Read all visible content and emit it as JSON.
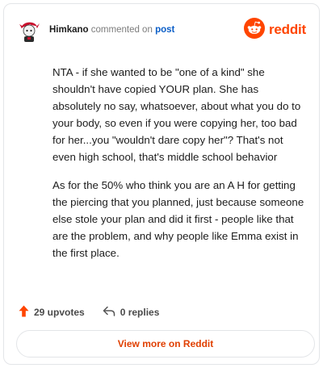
{
  "header": {
    "username": "Himkano",
    "verb": "commented on",
    "post_link": "post",
    "brand_name": "reddit"
  },
  "comment": {
    "paragraphs": [
      "NTA - if she wanted to be \"one of a kind\" she shouldn't have copied YOUR plan. She has absolutely no say, whatsoever, about what you do to your body, so even if you were copying her, too bad for her...you \"wouldn't dare copy her\"? That's not even high school, that's middle school behavior",
      "As for the 50% who think you are an A H for getting the piercing that you planned, just because someone else stole your plan and did it first - people like that are the problem, and why people like Emma exist in the first place."
    ]
  },
  "actions": {
    "upvotes": "29 upvotes",
    "replies": "0 replies"
  },
  "footer": {
    "view_more": "View more on Reddit"
  },
  "colors": {
    "brand": "#ff4500",
    "link": "#0b5ec7"
  },
  "icons": {
    "avatar": "avatar-icon",
    "brand": "reddit-logo-icon",
    "upvote": "upvote-arrow-icon",
    "reply": "reply-arrow-icon"
  }
}
